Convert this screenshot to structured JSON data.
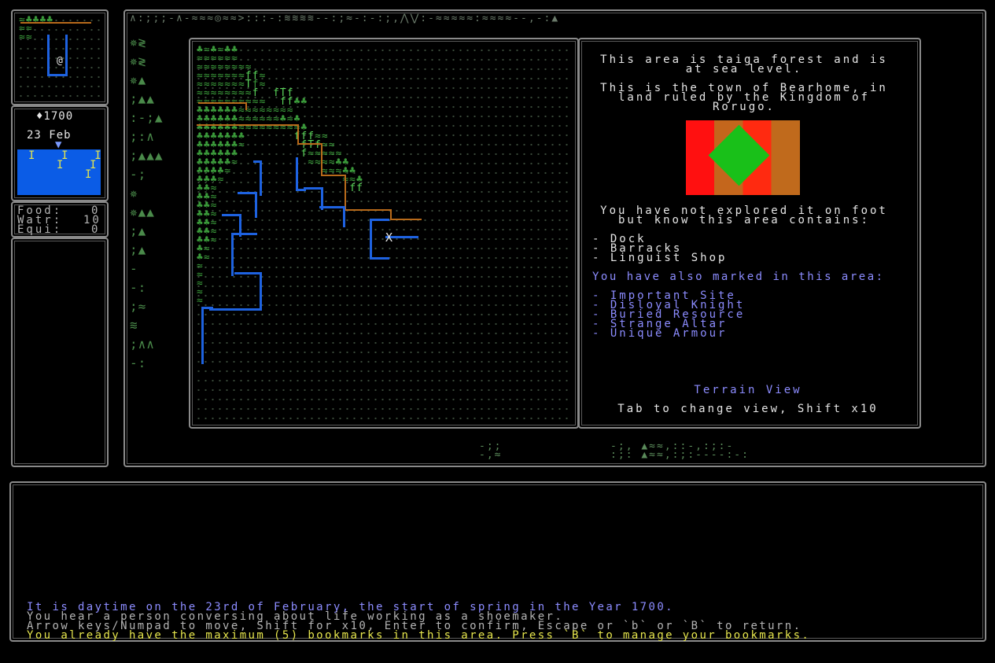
{
  "sidebar": {
    "year": "♦1700",
    "date": "23 Feb",
    "food_label": "Food:",
    "food_value": "0",
    "water_label": "Watr:",
    "water_value": "10",
    "equip_label": "Equi:",
    "equip_value": "0"
  },
  "info": {
    "line1": "This area is taiga forest and is",
    "line2": "at sea level.",
    "line3": "This is the town of Bearhome, in",
    "line4": "land ruled by the Kingdom of",
    "line5": "Rorugo.",
    "line6": "You have not explored it on foot",
    "line7": "but know this area contains:",
    "contains": [
      "- Dock",
      "- Barracks",
      "- Linguist Shop"
    ],
    "marked_header": "You have also marked in this area:",
    "marked": [
      "- Important Site",
      "- Disloyal Knight",
      "- Buried Resource",
      "- Strange Altar",
      "- Unique Armour"
    ],
    "view_name": "Terrain View",
    "view_hint": "Tab to change view, Shift x10"
  },
  "map": {
    "player_marker": "X",
    "minimap_player": "@"
  },
  "log": {
    "line1": "It is daytime on the 23rd of February, the start of spring in the Year 1700.",
    "line2": "You hear a person conversing about life working as a shoemaker.",
    "line3": "Arrow keys/Numpad to move, Shift for x10, Enter to confirm, Escape or `b` or `B` to return.",
    "line4": "You already have the maximum (5) bookmarks in this area. Press `B` to manage your bookmarks."
  },
  "colors": {
    "blue_text": "#8c8cff",
    "yellow_text": "#e6e64d",
    "river": "#1e62e0",
    "road": "#b86a1a",
    "forest": "#3a9a3a"
  }
}
